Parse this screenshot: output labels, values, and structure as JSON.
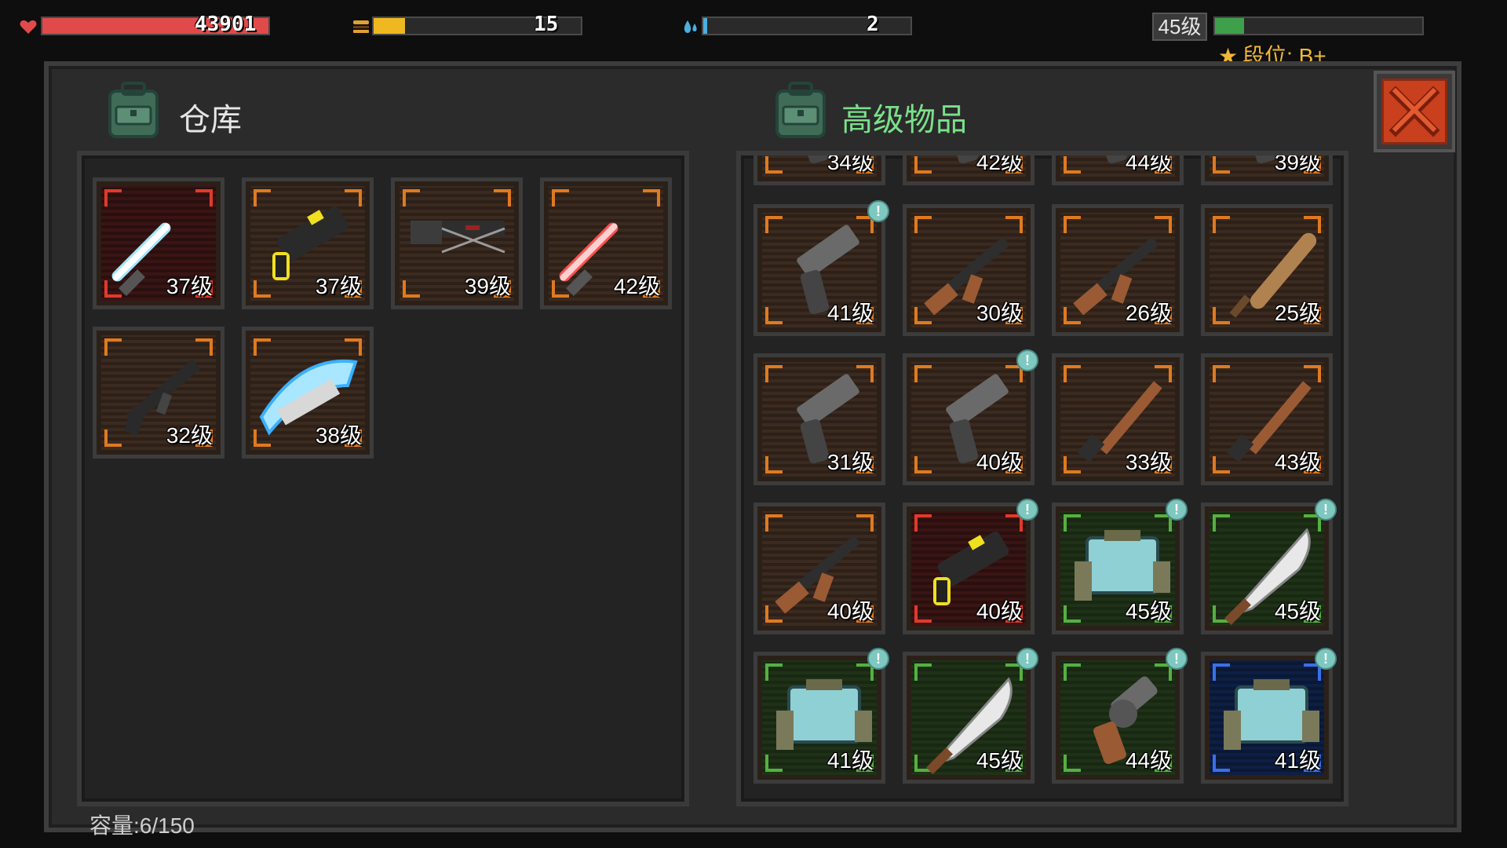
{
  "hud": {
    "health": {
      "value": "43901",
      "fill": 1.0,
      "color": "#e04a4a"
    },
    "hunger": {
      "value": "15",
      "fill": 0.15,
      "color": "#f0b820"
    },
    "water": {
      "value": "2",
      "fill": 0.02,
      "color": "#4ab0e0"
    },
    "level": "45级",
    "xp_fill": 0.14,
    "rank": "段位: B+"
  },
  "warehouse": {
    "title": "仓库",
    "capacity": "容量:6/150",
    "items": [
      {
        "name": "lightsaber-blue",
        "level": "37级",
        "rarity": "red",
        "icon": "lightsaber-blue-icon"
      },
      {
        "name": "plasma-gun",
        "level": "37级",
        "rarity": "orange",
        "icon": "plasma-gun-icon"
      },
      {
        "name": "crossbow",
        "level": "39级",
        "rarity": "orange",
        "icon": "crossbow-icon"
      },
      {
        "name": "lightsaber-red",
        "level": "42级",
        "rarity": "orange",
        "icon": "lightsaber-red-icon"
      },
      {
        "name": "assault-rifle",
        "level": "32级",
        "rarity": "orange",
        "icon": "assault-rifle-icon"
      },
      {
        "name": "thunder-blade",
        "level": "38级",
        "rarity": "orange",
        "icon": "thunder-blade-icon"
      }
    ]
  },
  "premium": {
    "title": "高级物品",
    "partial_top": [
      "34级",
      "42级",
      "44级",
      "39级"
    ],
    "items": [
      {
        "level": "41级",
        "rarity": "orange",
        "badge": true,
        "icon": "pistol-icon"
      },
      {
        "level": "30级",
        "rarity": "orange",
        "badge": false,
        "icon": "ak-rifle-icon"
      },
      {
        "level": "26级",
        "rarity": "orange",
        "badge": false,
        "icon": "ak-rifle-icon"
      },
      {
        "level": "25级",
        "rarity": "orange",
        "badge": false,
        "icon": "baseball-bat-icon"
      },
      {
        "level": "31级",
        "rarity": "orange",
        "badge": false,
        "icon": "pistol-icon"
      },
      {
        "level": "40级",
        "rarity": "orange",
        "badge": true,
        "icon": "pistol-icon"
      },
      {
        "level": "33级",
        "rarity": "orange",
        "badge": false,
        "icon": "shotgun-icon"
      },
      {
        "level": "43级",
        "rarity": "orange",
        "badge": false,
        "icon": "shotgun-icon"
      },
      {
        "level": "40级",
        "rarity": "orange",
        "badge": false,
        "icon": "ak-rifle-icon"
      },
      {
        "level": "40级",
        "rarity": "red",
        "badge": true,
        "icon": "plasma-gun-icon"
      },
      {
        "level": "45级",
        "rarity": "green",
        "badge": true,
        "icon": "armor-icon"
      },
      {
        "level": "45级",
        "rarity": "green",
        "badge": true,
        "icon": "machete-icon"
      },
      {
        "level": "41级",
        "rarity": "green",
        "badge": true,
        "icon": "armor-icon"
      },
      {
        "level": "45级",
        "rarity": "green",
        "badge": true,
        "icon": "machete-icon"
      },
      {
        "level": "44级",
        "rarity": "green",
        "badge": true,
        "icon": "revolver-icon"
      },
      {
        "level": "41级",
        "rarity": "blue",
        "badge": true,
        "icon": "armor-icon"
      }
    ]
  }
}
